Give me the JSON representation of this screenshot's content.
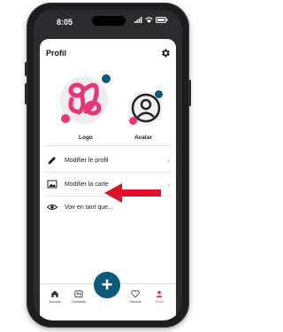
{
  "status": {
    "time": "8:05"
  },
  "profile": {
    "title": "Profil",
    "logo_label": "Logo",
    "avatar_label": "Avatar"
  },
  "menu": {
    "edit_profile": "Modifier le profil",
    "edit_card": "Modifier la carte",
    "view_as": "Voir en tant que..."
  },
  "tabbar": {
    "tab1": "Accueil",
    "tab2": "Contacts",
    "tab3": "Favoris",
    "tab4": "Profil"
  },
  "colors": {
    "brand_pink": "#e8357a",
    "fab": "#0a5a7a",
    "arrow": "#e0102a",
    "active_tab": "#e8357a"
  }
}
